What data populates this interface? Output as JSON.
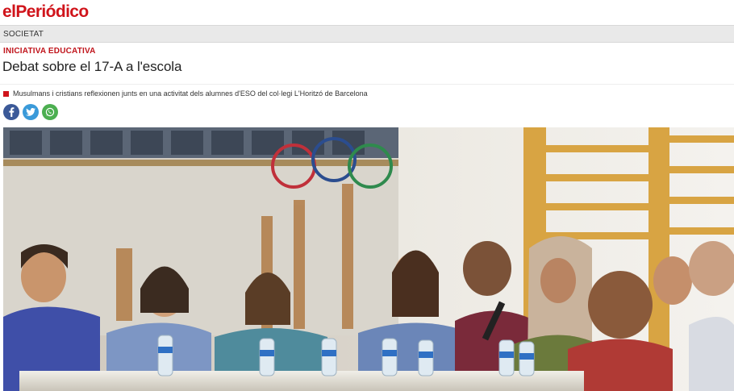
{
  "site": {
    "logo_prefix": "el",
    "logo_name": "Periódico",
    "brand_color": "#d0141b"
  },
  "section": {
    "label": "SOCIETAT"
  },
  "article": {
    "kicker": "INICIATIVA EDUCATIVA",
    "headline": "Debat sobre el 17-A a l'escola",
    "subtitle": "Musulmans i cristians reflexionen junts en una activitat dels alumnes d'ESO del col·legi L'Horitzó de Barcelona"
  },
  "share": {
    "buttons": [
      {
        "network": "facebook",
        "icon": "facebook-icon",
        "color": "#3b5998"
      },
      {
        "network": "twitter",
        "icon": "twitter-icon",
        "color": "#3a9ad9"
      },
      {
        "network": "whatsapp",
        "icon": "whatsapp-icon",
        "color": "#4caf50"
      }
    ]
  },
  "photo": {
    "subject": "lead-photo"
  }
}
